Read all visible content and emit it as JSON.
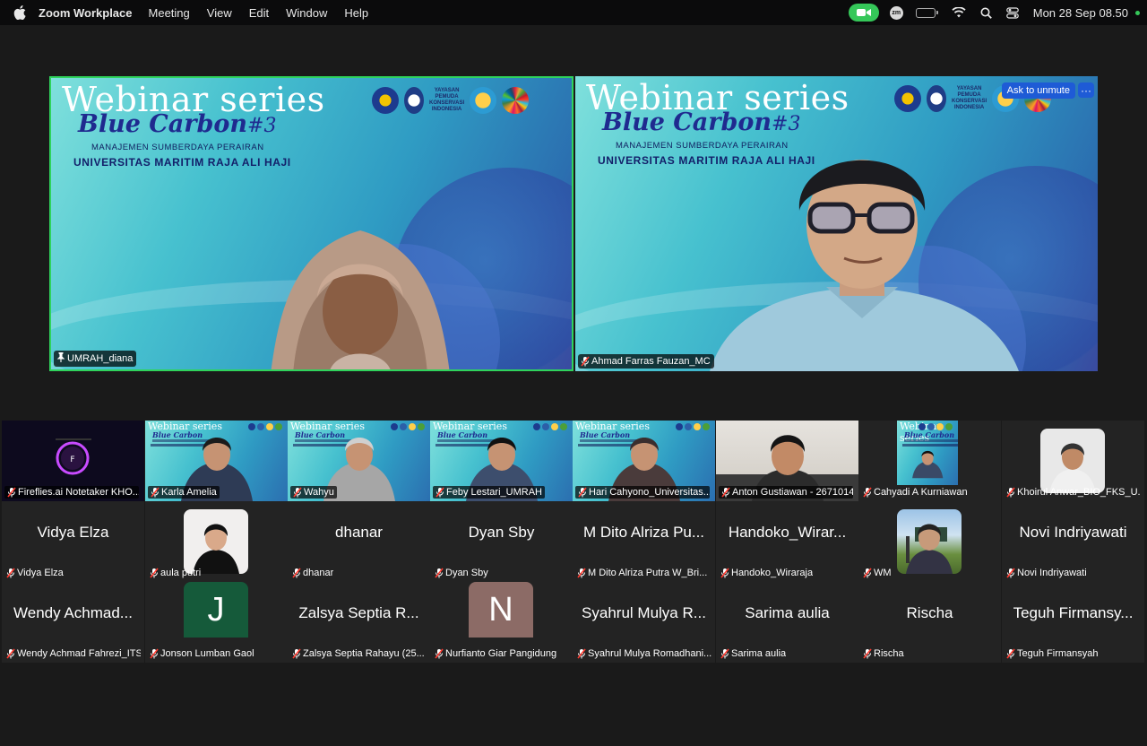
{
  "menubar": {
    "app_name": "Zoom Workplace",
    "menus": [
      "Meeting",
      "View",
      "Edit",
      "Window",
      "Help"
    ],
    "zoom_badge": "zm",
    "datetime": "Mon 28 Sep  08.50",
    "icons": [
      "apple-icon",
      "zoom-video-icon",
      "zoom-badge-icon",
      "battery-icon",
      "wifi-icon",
      "search-icon",
      "control-center-icon"
    ],
    "battery_level": 0.55,
    "accent": "#35c759"
  },
  "slide": {
    "title": "Webinar series",
    "blue_carbon": "Blue Carbon",
    "number": "#3",
    "line1": "MANAJEMEN SUMBERDAYA PERAIRAN",
    "line2": "UNIVERSITAS MARITIM RAJA ALI HAJI",
    "logo_text": "YAYASAN PEMUDA KONSERVASI INDONESIA"
  },
  "speakers": [
    {
      "name": "UMRAH_diana",
      "mic": "pinned"
    },
    {
      "name": "Ahmad Farras Fauzan_MC",
      "mic": "muted"
    }
  ],
  "ask_unmute_label": "Ask to unmute",
  "more_label": "···",
  "gallery": [
    {
      "name": "Fireflies.ai Notetaker KHO...",
      "kind": "video-dark"
    },
    {
      "name": "Karla Amelia",
      "kind": "video-slide"
    },
    {
      "name": "Wahyu",
      "kind": "video-slide"
    },
    {
      "name": "Feby Lestari_UMRAH",
      "kind": "video-slide"
    },
    {
      "name": "Hari Cahyono_Universitas...",
      "kind": "video-slide"
    },
    {
      "name": "Anton Gustiawan - 2671014",
      "kind": "video-room"
    },
    {
      "name": "Cahyadi A Kurniawan",
      "kind": "avatar-slide"
    },
    {
      "name": "Khoirul Anwar_BIO_FKS_U...",
      "kind": "avatar-photo"
    },
    {
      "name": "Vidya Elza",
      "display": "Vidya Elza",
      "kind": "text"
    },
    {
      "name": "aula putri",
      "kind": "avatar-photo"
    },
    {
      "name": "dhanar",
      "display": "dhanar",
      "kind": "text"
    },
    {
      "name": "Dyan Sby",
      "display": "Dyan Sby",
      "kind": "text"
    },
    {
      "name": "M Dito Alriza Putra W_Bri...",
      "display": "M Dito Alriza Pu...",
      "kind": "text"
    },
    {
      "name": "Handoko_Wiraraja",
      "display": "Handoko_Wirar...",
      "kind": "text"
    },
    {
      "name": "WM",
      "kind": "avatar-photo"
    },
    {
      "name": "Novi Indriyawati",
      "display": "Novi Indriyawati",
      "kind": "text"
    },
    {
      "name": "Wendy Achmad Fahrezi_ITS",
      "display": "Wendy Achmad...",
      "kind": "text"
    },
    {
      "name": "Jonson Lumban Gaol",
      "initial": "J",
      "kind": "initial",
      "color": "#155a3a"
    },
    {
      "name": "Zalsya Septia Rahayu (25...",
      "display": "Zalsya Septia R...",
      "kind": "text"
    },
    {
      "name": "Nurfianto Giar Pangidung",
      "initial": "N",
      "kind": "initial",
      "color": "#8c6b66"
    },
    {
      "name": "Syahrul Mulya Romadhani...",
      "display": "Syahrul Mulya R...",
      "kind": "text"
    },
    {
      "name": "Sarima aulia",
      "display": "Sarima aulia",
      "kind": "text"
    },
    {
      "name": "Rischa",
      "display": "Rischa",
      "kind": "text"
    },
    {
      "name": "Teguh Firmansyah",
      "display": "Teguh Firmansy...",
      "kind": "text"
    }
  ]
}
